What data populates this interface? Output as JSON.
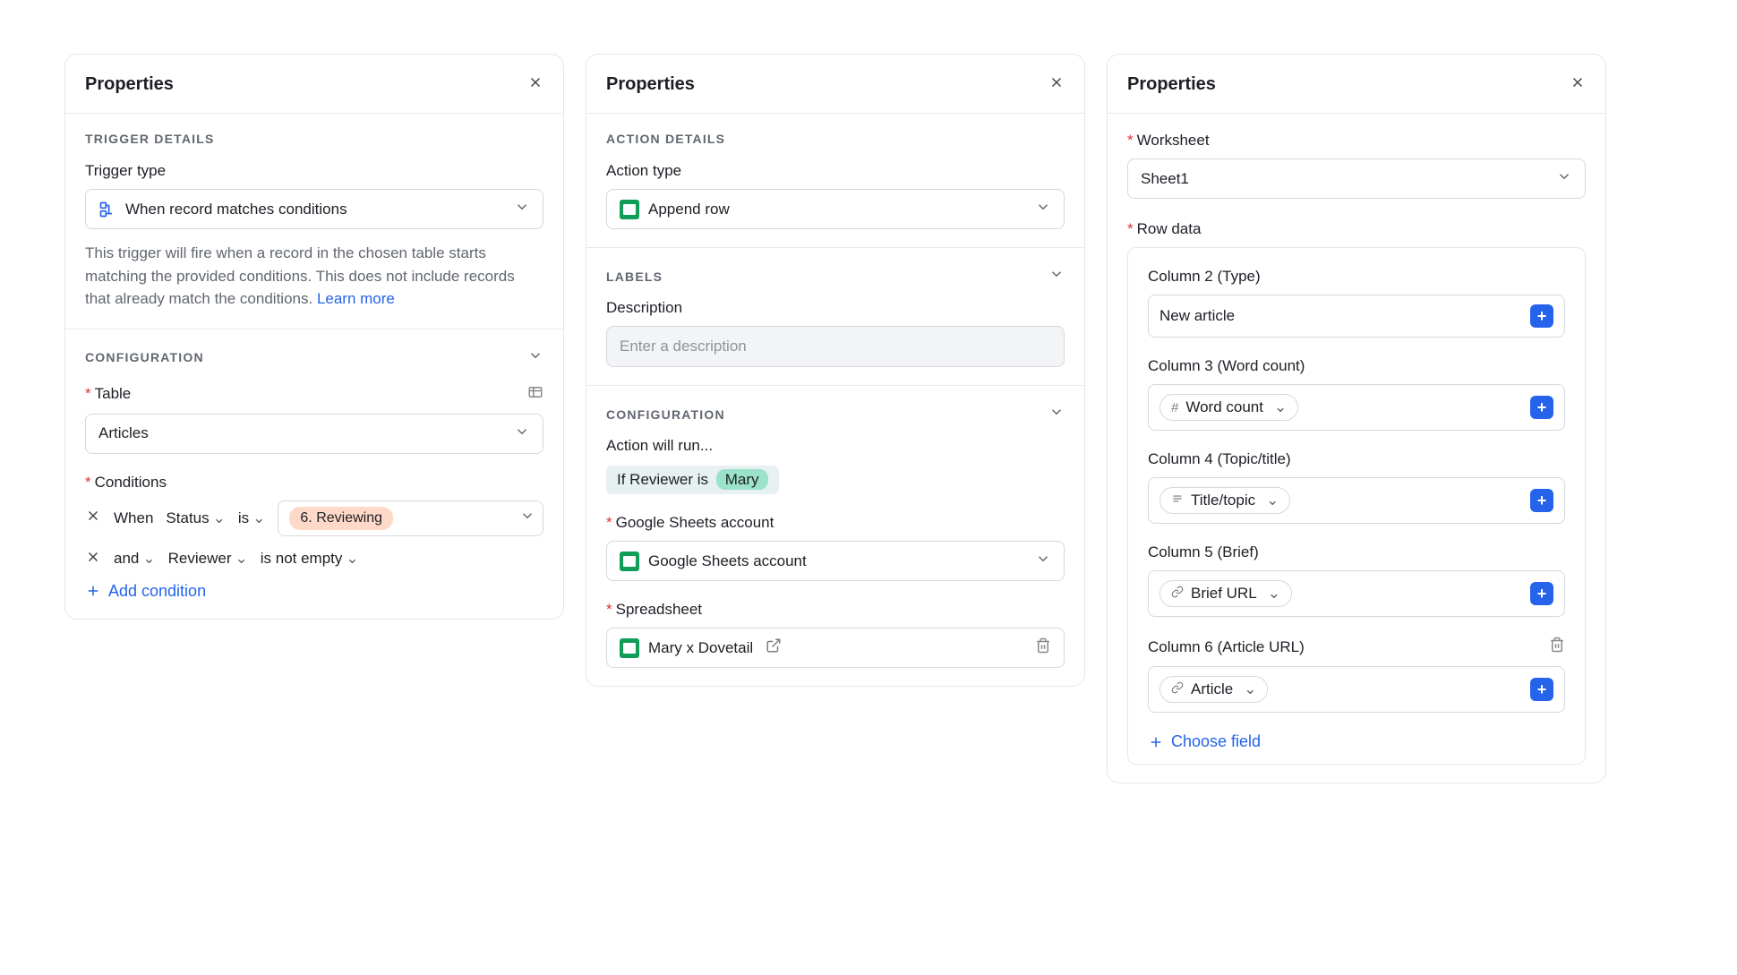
{
  "panel1": {
    "title": "Properties",
    "trigger_section": "TRIGGER DETAILS",
    "trigger_type_label": "Trigger type",
    "trigger_type_value": "When record matches conditions",
    "trigger_desc": "This trigger will fire when a record in the chosen table starts matching the provided conditions. This does not include records that already match the conditions. ",
    "learn_more": "Learn more",
    "config_section": "CONFIGURATION",
    "table_label": "Table",
    "table_value": "Articles",
    "conditions_label": "Conditions",
    "cond1_when": "When",
    "cond1_field": "Status",
    "cond1_op": "is",
    "cond1_value": "6. Reviewing",
    "cond2_and": "and",
    "cond2_field": "Reviewer",
    "cond2_op": "is not empty",
    "add_condition": "Add condition"
  },
  "panel2": {
    "title": "Properties",
    "action_section": "ACTION DETAILS",
    "action_type_label": "Action type",
    "action_type_value": "Append row",
    "labels_section": "LABELS",
    "description_label": "Description",
    "description_placeholder": "Enter a description",
    "config_section": "CONFIGURATION",
    "action_will_run": "Action will run...",
    "cond_text": "If Reviewer is",
    "cond_name": "Mary",
    "account_label": "Google Sheets account",
    "account_value": "Google Sheets account",
    "spreadsheet_label": "Spreadsheet",
    "spreadsheet_value": "Mary x Dovetail"
  },
  "panel3": {
    "title": "Properties",
    "worksheet_label": "Worksheet",
    "worksheet_value": "Sheet1",
    "row_data_label": "Row data",
    "col2_label": "Column 2 (Type)",
    "col2_value": "New article",
    "col3_label": "Column 3 (Word count)",
    "col3_token": "Word count",
    "col4_label": "Column 4 (Topic/title)",
    "col4_token": "Title/topic",
    "col5_label": "Column 5 (Brief)",
    "col5_token": "Brief URL",
    "col6_label": "Column 6 (Article URL)",
    "col6_token": "Article",
    "choose_field": "Choose field"
  }
}
